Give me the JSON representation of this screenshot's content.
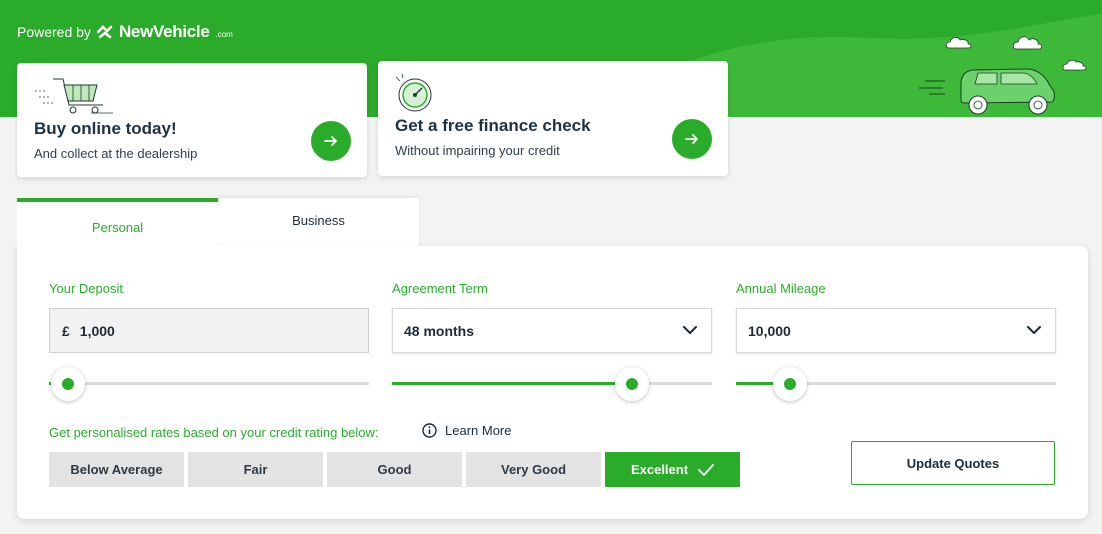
{
  "brand": {
    "powered_by": "Powered by",
    "logo_text": "NewVehicle",
    "logo_suffix": ".com"
  },
  "promos": [
    {
      "title": "Buy online today!",
      "subtitle": "And collect at the dealership",
      "icon": "shopping-cart-icon"
    },
    {
      "title": "Get a free finance check",
      "subtitle": "Without impairing your credit",
      "icon": "speedometer-icon"
    }
  ],
  "tabs": [
    {
      "label": "Personal",
      "active": true
    },
    {
      "label": "Business",
      "active": false
    }
  ],
  "fields": {
    "deposit": {
      "label": "Your Deposit",
      "currency": "£",
      "value": "1,000",
      "slider_fraction": 0.06
    },
    "term": {
      "label": "Agreement Term",
      "value": "48 months",
      "slider_fraction": 0.75
    },
    "mileage": {
      "label": "Annual Mileage",
      "value": "10,000",
      "slider_fraction": 0.17
    }
  },
  "credit": {
    "prompt": "Get personalised rates based on your credit rating below:",
    "learn_more": "Learn More",
    "ratings": [
      "Below Average",
      "Fair",
      "Good",
      "Very Good",
      "Excellent"
    ],
    "selected": "Excellent"
  },
  "update_button": "Update Quotes",
  "colors": {
    "accent": "#2aac2a",
    "panel": "#ffffff",
    "background": "#f3f3f3"
  }
}
